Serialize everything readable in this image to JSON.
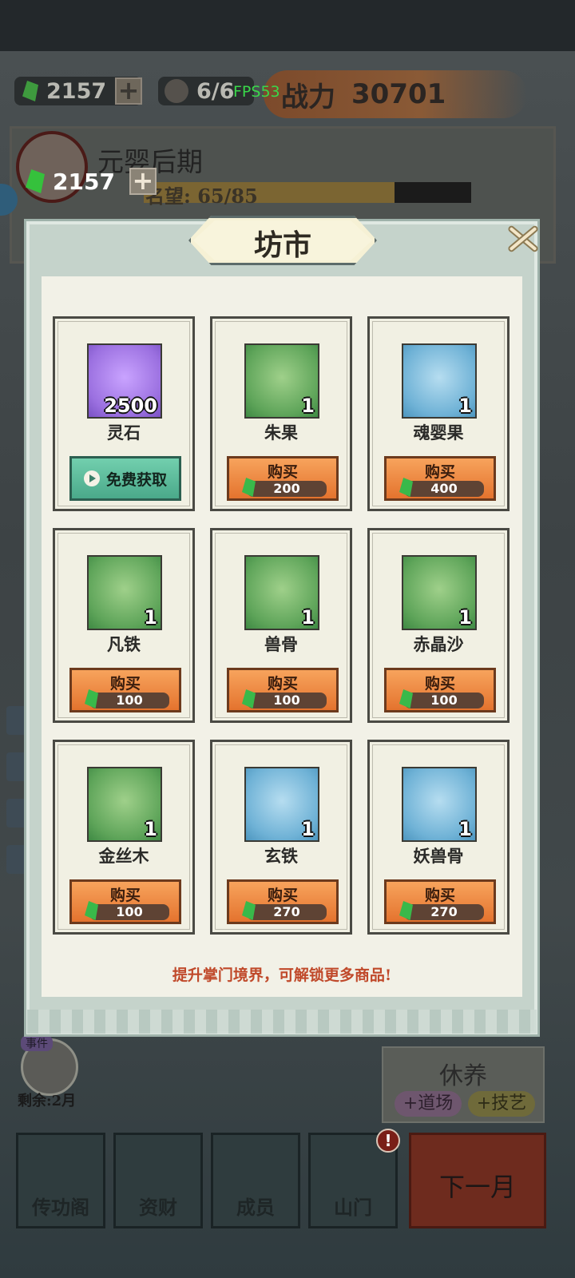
{
  "hud": {
    "gems": "2157",
    "members": "6/6",
    "fps": "FPS53",
    "power_label": "战力",
    "power_value": "30701",
    "plus": "+"
  },
  "profile": {
    "rank_title": "元婴后期",
    "fame_label": "名望:",
    "fame_value": "65/85",
    "fame_progress": 0.765,
    "gem_overlay": "2157"
  },
  "modal": {
    "title": "坊市",
    "tip": "提升掌门境界，可解锁更多商品!",
    "items": [
      {
        "name": "灵石",
        "qty": "2500",
        "bg": "purple",
        "icon": "spirit-stone-icon",
        "action": "free",
        "button": "免费获取"
      },
      {
        "name": "朱果",
        "qty": "1",
        "bg": "green",
        "icon": "vermilion-fruit-icon",
        "action": "buy",
        "button": "购买",
        "price": "200"
      },
      {
        "name": "魂婴果",
        "qty": "1",
        "bg": "blue",
        "icon": "soul-infant-fruit-icon",
        "action": "buy",
        "button": "购买",
        "price": "400"
      },
      {
        "name": "凡铁",
        "qty": "1",
        "bg": "green",
        "icon": "iron-ingot-icon",
        "action": "buy",
        "button": "购买",
        "price": "100"
      },
      {
        "name": "兽骨",
        "qty": "1",
        "bg": "green",
        "icon": "beast-bone-icon",
        "action": "buy",
        "button": "购买",
        "price": "100"
      },
      {
        "name": "赤晶沙",
        "qty": "1",
        "bg": "green",
        "icon": "red-crystal-sand-icon",
        "action": "buy",
        "button": "购买",
        "price": "100"
      },
      {
        "name": "金丝木",
        "qty": "1",
        "bg": "green",
        "icon": "golden-wood-icon",
        "action": "buy",
        "button": "购买",
        "price": "100"
      },
      {
        "name": "玄铁",
        "qty": "1",
        "bg": "blue",
        "icon": "dark-iron-icon",
        "action": "buy",
        "button": "购买",
        "price": "270"
      },
      {
        "name": "妖兽骨",
        "qty": "1",
        "bg": "blue",
        "icon": "demon-beast-bone-icon",
        "action": "buy",
        "button": "购买",
        "price": "270"
      }
    ]
  },
  "bottom": {
    "event_tag": "事件",
    "remaining": "剩余:2月",
    "rest_title": "休养",
    "rest_tags": [
      "+道场",
      "+技艺"
    ],
    "nav": [
      "传功阁",
      "资财",
      "成员",
      "山门"
    ],
    "nav_badge": "!",
    "next_month": "下一月"
  },
  "colors": {
    "buy_button": "#e4732e",
    "free_button": "#4aa98a",
    "tip_text": "#c0492a",
    "gem": "#39b94a"
  }
}
